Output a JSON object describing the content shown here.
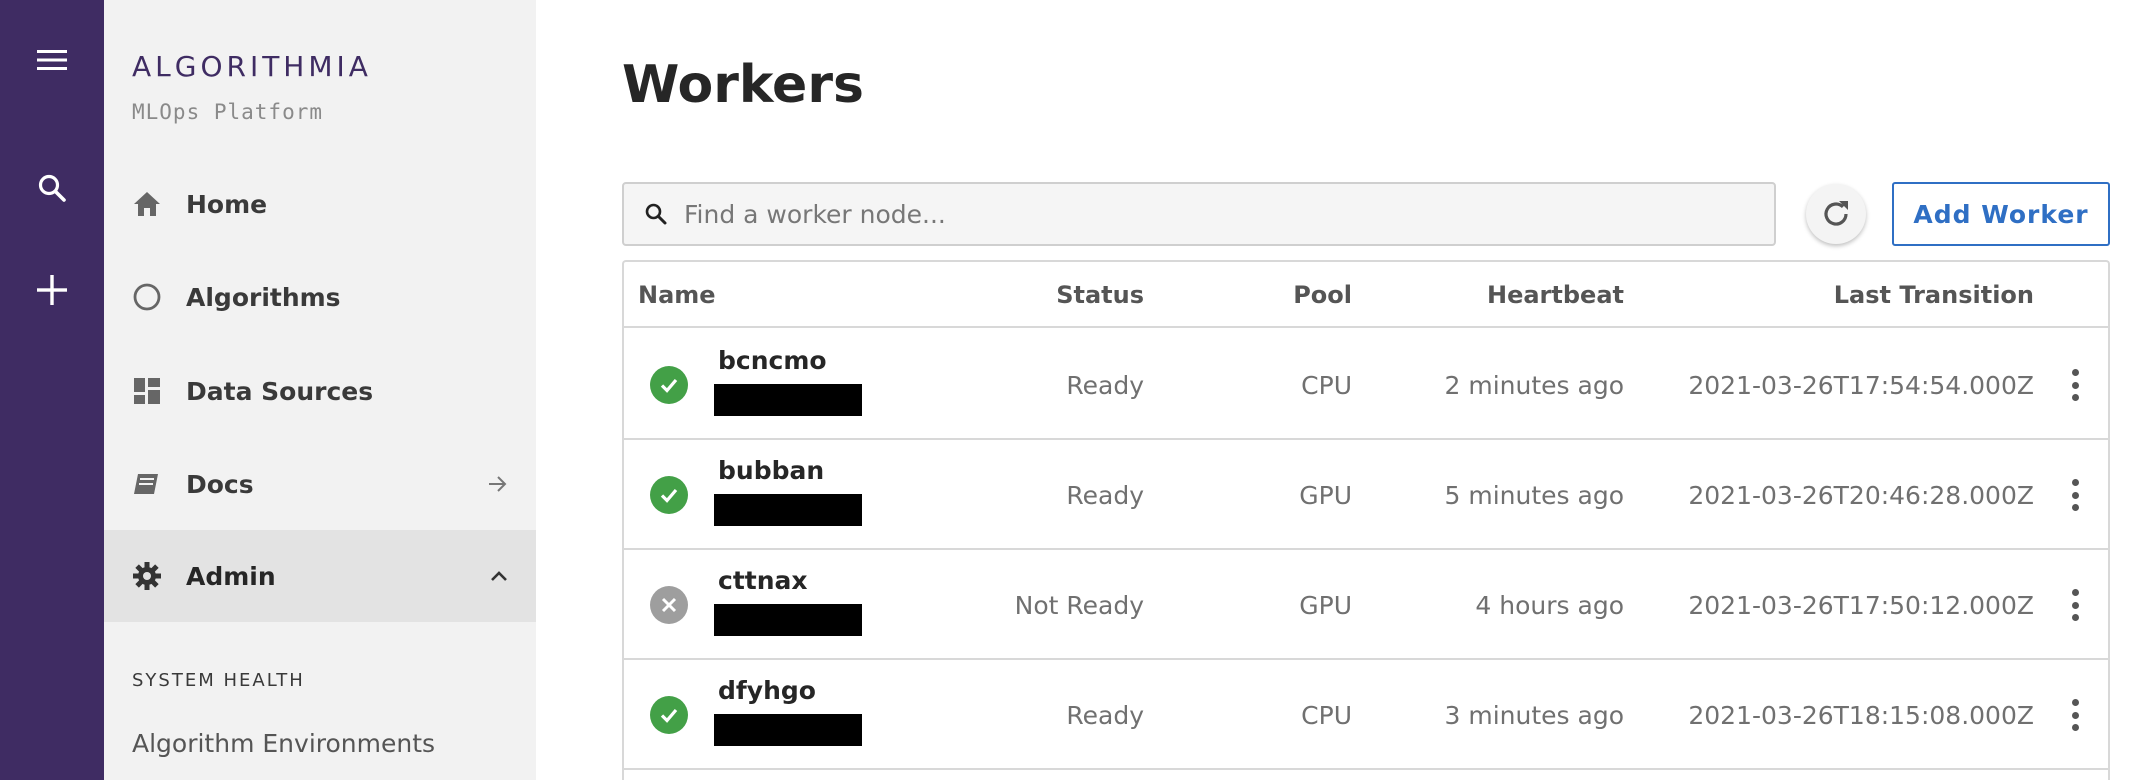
{
  "rail": {
    "menu_icon": "hamburger-menu-icon",
    "search_icon": "search-icon",
    "add_icon": "plus-icon",
    "background": "#3f2c63"
  },
  "sidebar": {
    "brand": "ALGORITHMIA",
    "subtitle": "MLOps Platform",
    "items": [
      {
        "label": "Home",
        "icon": "home-icon"
      },
      {
        "label": "Algorithms",
        "icon": "circle-icon"
      },
      {
        "label": "Data Sources",
        "icon": "dashboard-icon"
      },
      {
        "label": "Docs",
        "icon": "book-icon",
        "trail_icon": "arrow-right-icon"
      },
      {
        "label": "Admin",
        "icon": "gear-icon",
        "trail_icon": "chevron-up-icon",
        "active": true
      }
    ],
    "section_heading": "SYSTEM HEALTH",
    "section_links": [
      "Algorithm Environments"
    ]
  },
  "main": {
    "title": "Workers",
    "search_placeholder": "Find a worker node...",
    "refresh_icon": "refresh-icon",
    "add_button": "Add Worker",
    "accent": "#2f6fc4",
    "columns": {
      "name": "Name",
      "status": "Status",
      "pool": "Pool",
      "heartbeat": "Heartbeat",
      "last_transition": "Last Transition"
    },
    "rows": [
      {
        "name": "bcncmo",
        "status": "Ready",
        "pool": "CPU",
        "heartbeat": "2 minutes ago",
        "last_transition": "2021-03-26T17:54:54.000Z",
        "ready": true
      },
      {
        "name": "bubban",
        "status": "Ready",
        "pool": "GPU",
        "heartbeat": "5 minutes ago",
        "last_transition": "2021-03-26T20:46:28.000Z",
        "ready": true
      },
      {
        "name": "cttnax",
        "status": "Not Ready",
        "pool": "GPU",
        "heartbeat": "4 hours ago",
        "last_transition": "2021-03-26T17:50:12.000Z",
        "ready": false
      },
      {
        "name": "dfyhgo",
        "status": "Ready",
        "pool": "CPU",
        "heartbeat": "3 minutes ago",
        "last_transition": "2021-03-26T18:15:08.000Z",
        "ready": true
      }
    ],
    "status_colors": {
      "ready": "#43a047",
      "not_ready": "#9e9e9e"
    }
  }
}
